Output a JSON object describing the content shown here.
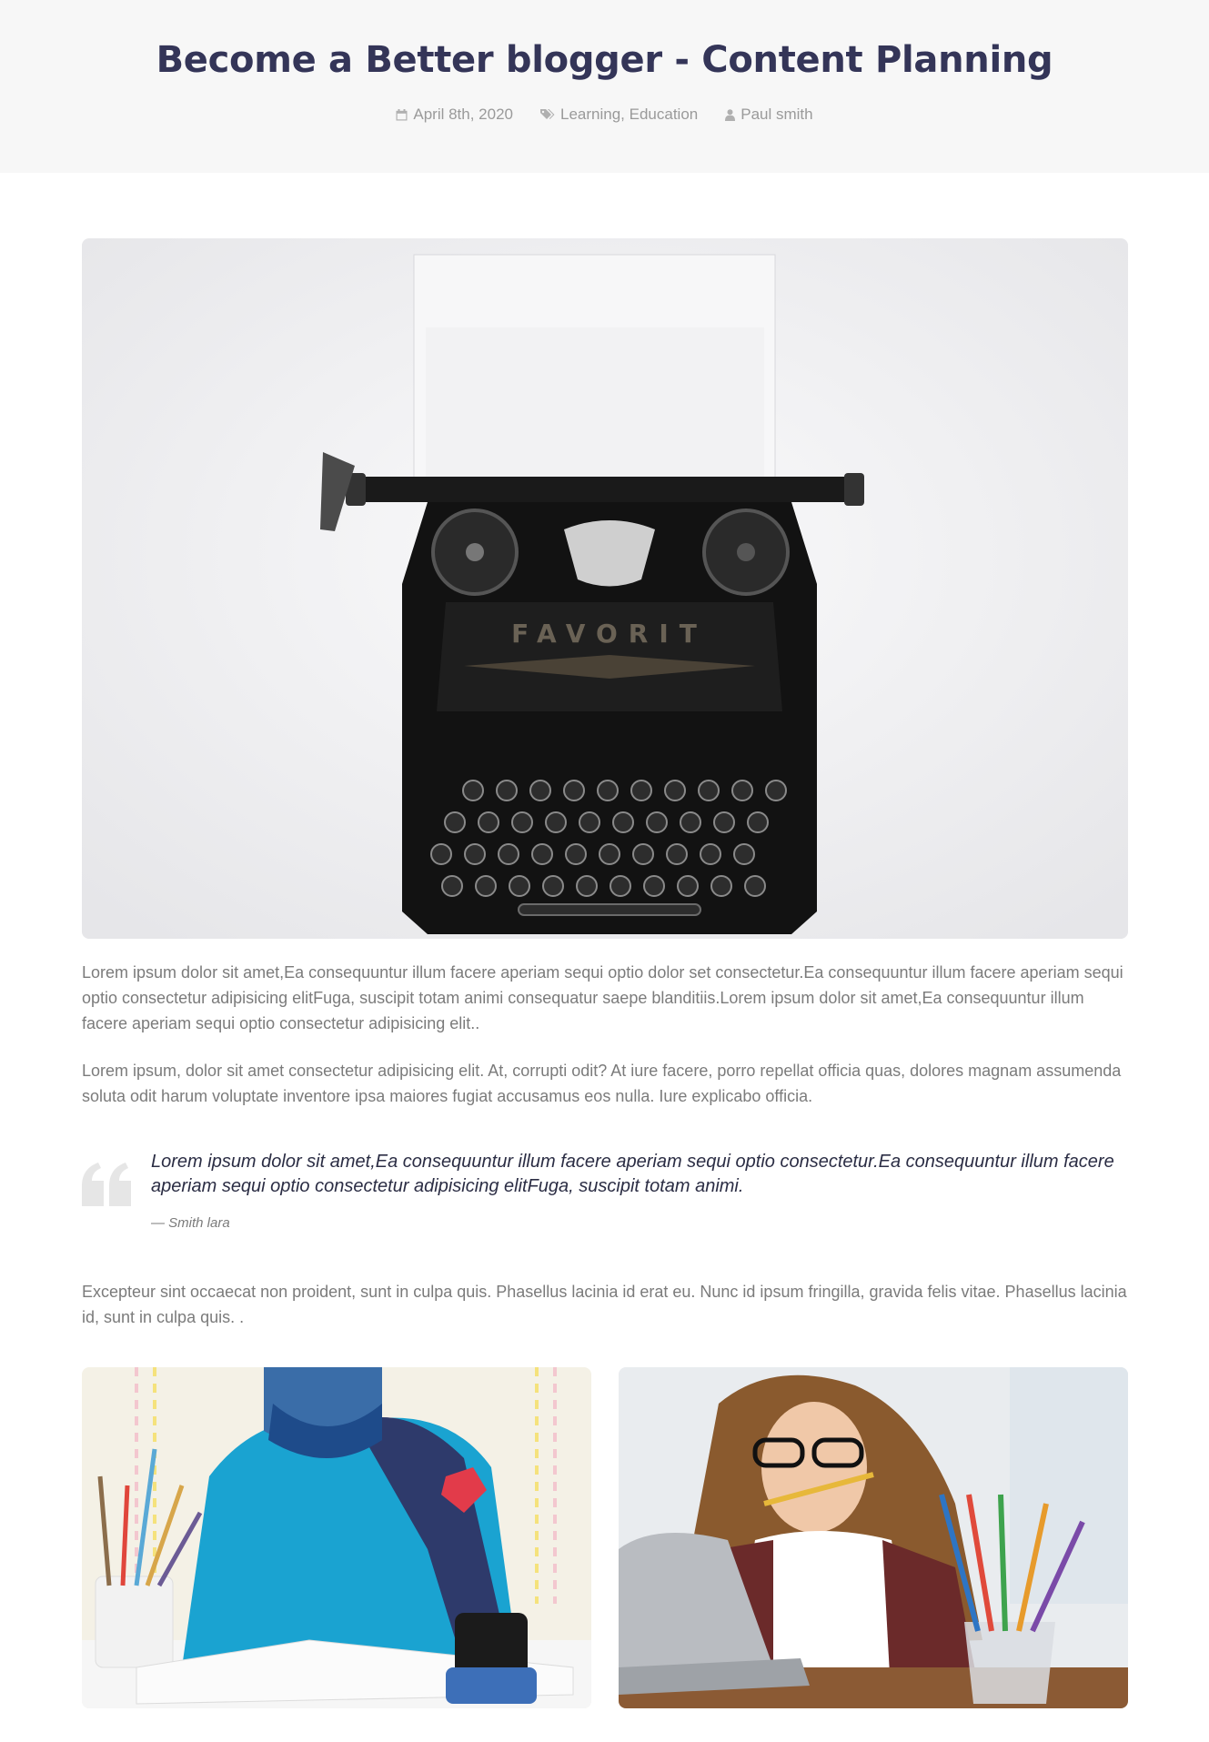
{
  "post": {
    "title": "Become a Better blogger - Content Planning",
    "meta": {
      "date": "April 8th, 2020",
      "categories": "Learning, Education",
      "author": "Paul smith"
    }
  },
  "images": {
    "feature": {
      "icon": "typewriter-photo",
      "brand_text": "FAVORIT"
    },
    "left_thumb": {
      "icon": "person-drawing-photo"
    },
    "right_thumb": {
      "icon": "woman-with-laptop-photo"
    }
  },
  "content": {
    "paragraph_1": "Lorem ipsum dolor sit amet,Ea consequuntur illum facere aperiam sequi optio dolor set consectetur.Ea consequuntur illum facere aperiam sequi optio consectetur adipisicing elitFuga, suscipit totam animi consequatur saepe blanditiis.Lorem ipsum dolor sit amet,Ea consequuntur illum facere aperiam sequi optio consectetur adipisicing elit..",
    "paragraph_2": "Lorem ipsum, dolor sit amet consectetur adipisicing elit. At, corrupti odit? At iure facere, porro repellat officia quas, dolores magnam assumenda soluta odit harum voluptate inventore ipsa maiores fugiat accusamus eos nulla. Iure explicabo officia.",
    "quote": {
      "text": "Lorem ipsum dolor sit amet,Ea consequuntur illum facere aperiam sequi optio consectetur.Ea consequuntur illum facere aperiam sequi optio consectetur adipisicing elitFuga, suscipit totam animi.",
      "author": "— Smith lara"
    },
    "paragraph_3": "Excepteur sint occaecat non proident, sunt in culpa quis. Phasellus lacinia id erat eu. Nunc id ipsum fringilla, gravida felis vitae. Phasellus lacinia id, sunt in culpa quis. ."
  },
  "colors": {
    "title": "#343558",
    "meta": "#9a9a9a",
    "body_text": "#7b7b7b",
    "hero_bg": "#f7f7f7"
  }
}
